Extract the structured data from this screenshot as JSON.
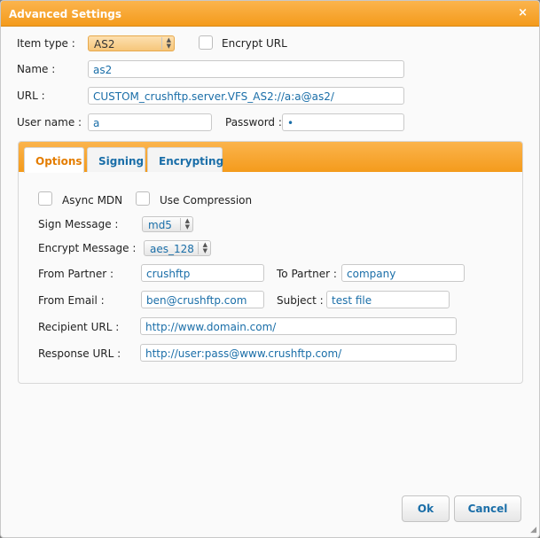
{
  "dialog": {
    "title": "Advanced Settings",
    "close_glyph": "×"
  },
  "form": {
    "item_type": {
      "label": "Item type :",
      "value": "AS2"
    },
    "encrypt_url": {
      "label": "Encrypt URL",
      "checked": false
    },
    "name": {
      "label": "Name :",
      "value": "as2"
    },
    "url": {
      "label": "URL :",
      "value": "CUSTOM_crushftp.server.VFS_AS2://a:a@as2/"
    },
    "username": {
      "label": "User name :",
      "value": "a"
    },
    "password": {
      "label": "Password :",
      "value": "•"
    }
  },
  "tabs": [
    {
      "label": "Options",
      "selected": true
    },
    {
      "label": "Signing",
      "selected": false
    },
    {
      "label": "Encrypting",
      "selected": false
    }
  ],
  "options": {
    "async_mdn": {
      "label": "Async MDN",
      "checked": false
    },
    "use_compression": {
      "label": "Use Compression",
      "checked": false
    },
    "sign_message": {
      "label": "Sign Message :",
      "value": "md5"
    },
    "encrypt_message": {
      "label": "Encrypt Message :",
      "value": "aes_128"
    },
    "from_partner": {
      "label": "From Partner :",
      "value": "crushftp"
    },
    "to_partner": {
      "label": "To Partner :",
      "value": "company"
    },
    "from_email": {
      "label": "From Email :",
      "value": "ben@crushftp.com"
    },
    "subject": {
      "label": "Subject :",
      "value": "test file"
    },
    "recipient_url": {
      "label": "Recipient URL :",
      "value": "http://www.domain.com/"
    },
    "response_url": {
      "label": "Response URL :",
      "value": "http://user:pass@www.crushftp.com/"
    }
  },
  "buttons": {
    "ok": "Ok",
    "cancel": "Cancel"
  },
  "colors": {
    "accent": "#f49b1c",
    "link_text": "#1a6ea8"
  }
}
